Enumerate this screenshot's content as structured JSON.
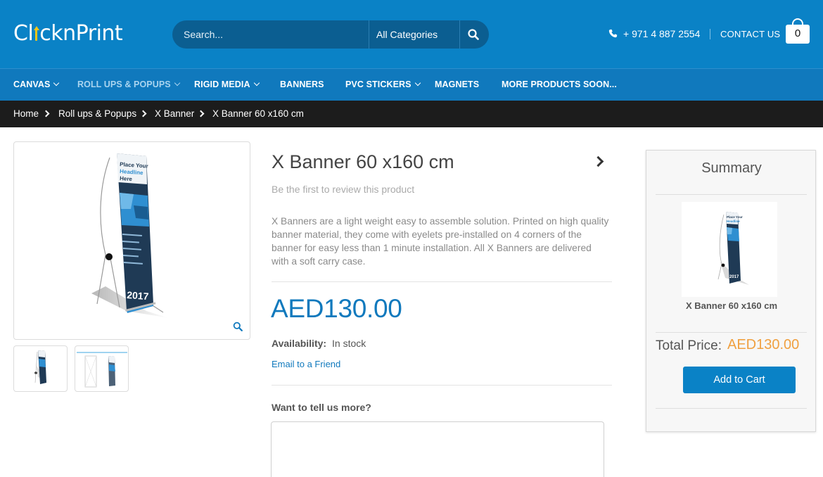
{
  "header": {
    "logo_text": "ClicknPrint",
    "search": {
      "placeholder": "Search...",
      "category": "All Categories"
    },
    "phone": "+ 971 4 887 2554",
    "contact": "CONTACT US",
    "cart_count": "0"
  },
  "nav": {
    "items": [
      {
        "label": "CANVAS",
        "has_dropdown": true
      },
      {
        "label": "ROLL UPS & POPUPS",
        "has_dropdown": true,
        "active": true
      },
      {
        "label": "RIGID MEDIA",
        "has_dropdown": true
      },
      {
        "label": "BANNERS",
        "has_dropdown": false
      },
      {
        "label": "PVC STICKERS",
        "has_dropdown": true
      },
      {
        "label": "MAGNETS",
        "has_dropdown": false
      },
      {
        "label": "MORE PRODUCTS SOON...",
        "has_dropdown": false
      }
    ]
  },
  "breadcrumb": [
    "Home",
    "Roll ups & Popups",
    "X Banner",
    "X Banner 60 x160 cm"
  ],
  "product": {
    "title": "X Banner 60 x160 cm",
    "review_prompt": "Be the first to review this product",
    "description": "X Banners are a light weight easy to assemble solution. Printed on high quality banner material, they come with eyelets pre-installed on 4 corners of the banner for easy less than 1 minute installation. All X Banners are delivered with a soft carry case.",
    "price": "AED130.00",
    "availability_label": "Availability:",
    "availability_value": "In stock",
    "email_link": "Email to a Friend",
    "tell_more_label": "Want to tell us more?",
    "banner_art": {
      "headline": "Place Your Headline Here",
      "year": "2017"
    }
  },
  "summary": {
    "title": "Summary",
    "product_name": "X Banner 60 x160 cm",
    "total_label": "Total Price:",
    "total_value": "AED130.00",
    "add_to_cart": "Add to Cart"
  },
  "colors": {
    "header_bg": "#0a82c6",
    "nav_bg": "#1079bd",
    "breadcrumb_bg": "#1c1c1c",
    "price": "#1079bd",
    "total_price": "#f0a040"
  }
}
